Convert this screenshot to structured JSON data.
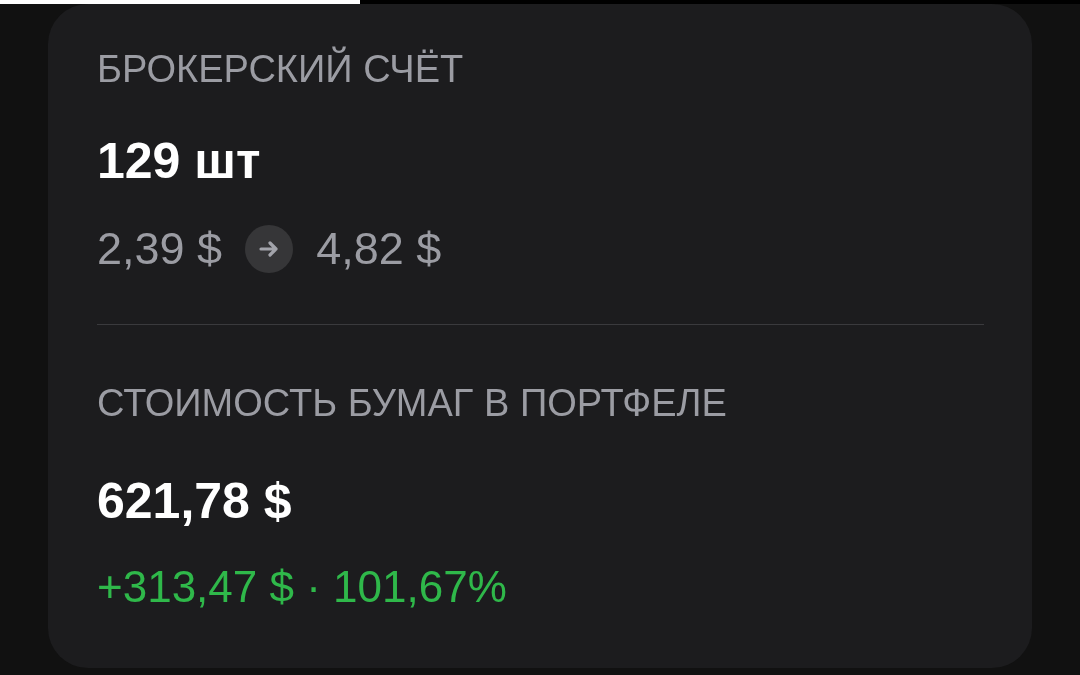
{
  "account": {
    "title": "БРОКЕРСКИЙ СЧЁТ",
    "quantity": "129 шт",
    "price_from": "2,39 $",
    "price_to": "4,82 $"
  },
  "portfolio": {
    "title": "СТОИМОСТЬ БУМАГ В ПОРТФЕЛЕ",
    "value": "621,78 $",
    "change": "+313,47 $ · 101,67%",
    "positive": true
  }
}
